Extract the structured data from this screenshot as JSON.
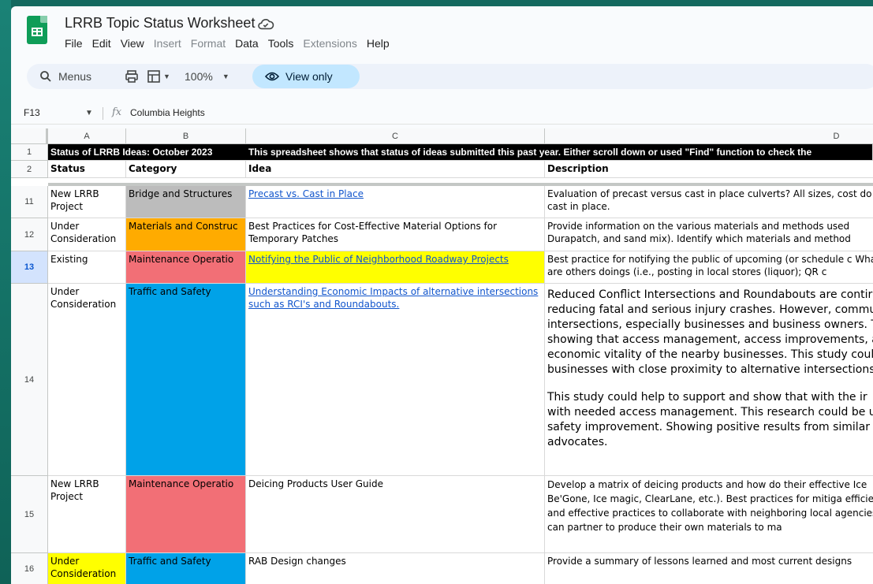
{
  "app": {
    "title": "LRRB Topic Status Worksheet",
    "menu": [
      "File",
      "Edit",
      "View",
      "Insert",
      "Format",
      "Data",
      "Tools",
      "Extensions",
      "Help"
    ],
    "menu_disabled": [
      "Insert",
      "Format",
      "Extensions"
    ]
  },
  "toolbar": {
    "menus_label": "Menus",
    "zoom": "100%",
    "view_only_label": "View only"
  },
  "formula_bar": {
    "cell_ref": "F13",
    "fx": "fx",
    "value": "Columbia Heights"
  },
  "columns": [
    "A",
    "B",
    "C",
    "D"
  ],
  "rows": {
    "r1": {
      "num": "1",
      "a": "Status of LRRB Ideas: October 2023",
      "c": "This spreadsheet shows that status of ideas submitted this past year.  Either scroll down or used \"Find\" function to check the"
    },
    "r2": {
      "num": "2",
      "status": "Status",
      "category": "Category",
      "idea": "Idea",
      "description": "Description"
    },
    "r11": {
      "num": "11",
      "status": "New LRRB Project",
      "category": "Bridge and Structures",
      "idea": "Precast vs. Cast in Place",
      "description": "Evaluation of precast versus cast in place culverts? All sizes, cost do cast in place."
    },
    "r12": {
      "num": "12",
      "status": "Under Consideration",
      "category": "Materials and Construc",
      "idea": "Best Practices for Cost-Effective Material Options for Temporary Patches",
      "description": "Provide information on the various materials and methods used Durapatch, and sand mix). Identify which materials and method"
    },
    "r13": {
      "num": "13",
      "status": "Existing",
      "category": "Maintenance Operatio",
      "idea": "Notifying the Public of Neighborhood Roadway Projects",
      "description": "Best practice for notifying the public of upcoming (or schedule c What are others doings (i.e., posting in local stores (liquor); QR c"
    },
    "r14": {
      "num": "14",
      "status": "Under Consideration",
      "category": "Traffic and Safety",
      "idea": "Understanding Economic Impacts of alternative intersections such as RCI's and Roundabouts.",
      "description_p1": "Reduced Conflict Intersections and Roundabouts are contir reducing fatal and serious injury crashes. However, commu intersections, especially businesses and business owners. T showing that access management, access improvements, a economic vitality of the nearby businesses. This study coul businesses with close proximity to alternative intersections",
      "description_p2": " This study could help to support and show that with the ir with needed access management. This research could be u safety improvement. Showing positive results from similar advocates."
    },
    "r15": {
      "num": "15",
      "status": "New LRRB Project",
      "category": "Maintenance Operatio",
      "idea": "Deicing Products User Guide",
      "description": "Develop a matrix of deicing products and how do their effective Ice Be'Gone, Ice magic, ClearLane, etc.). Best practices for mitiga efficient and effective practices to collaborate with neighboring local agencies can partner to produce their own materials to ma"
    },
    "r16": {
      "num": "16",
      "status": "Under Consideration",
      "category": "Traffic and Safety",
      "idea": "RAB Design changes",
      "description": "Provide a summary of lessons learned and most current designs"
    }
  },
  "colors": {
    "bridge": "#bcbcbc",
    "materials": "#ffab00",
    "maintenance": "#f26f76",
    "traffic": "#00a2e8",
    "yellow": "#ffff00",
    "selected_row": "#d3e3fd"
  }
}
